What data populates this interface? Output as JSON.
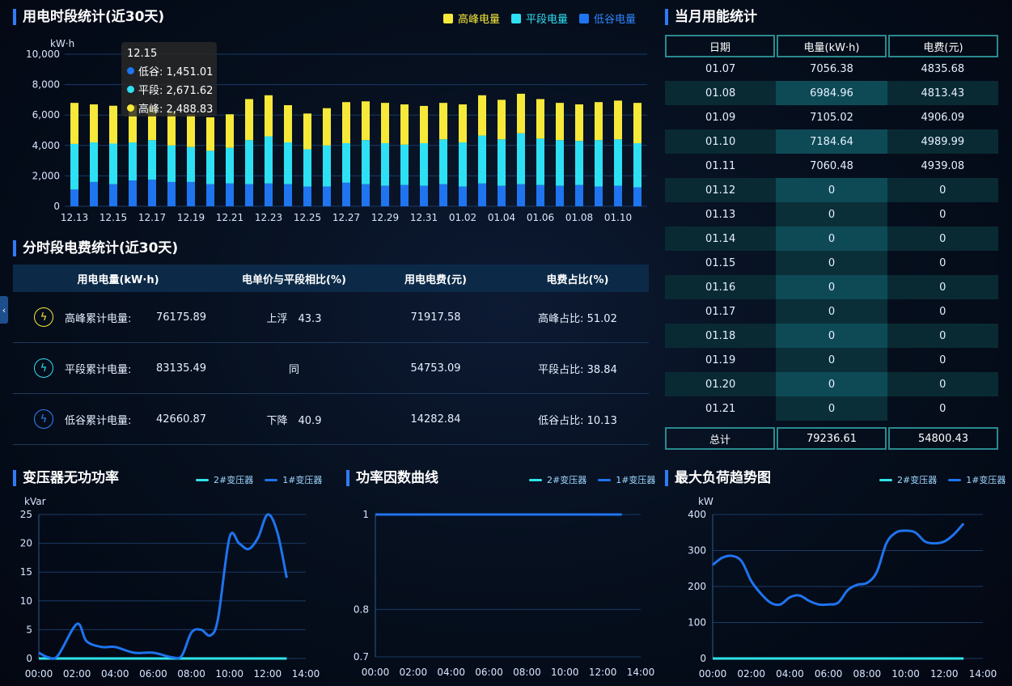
{
  "colors": {
    "peak": "#f7e93a",
    "flat": "#2ee0f4",
    "valley": "#1f74ef",
    "t2": "#2fe4e8",
    "t1": "#1f74ef"
  },
  "usage_chart": {
    "title": "用电时段统计(近30天)",
    "unit": "kW·h",
    "legend": {
      "peak": "高峰电量",
      "flat": "平段电量",
      "valley": "低谷电量"
    },
    "tooltip": {
      "date": "12.15",
      "valley": "低谷: 1,451.01",
      "flat": "平段: 2,671.62",
      "peak": "高峰: 2,488.83"
    },
    "chart_data": {
      "type": "bar",
      "title": "用电时段统计(近30天)",
      "ylabel": "kW·h",
      "ylim": [
        0,
        10000
      ],
      "yticks": [
        "10,000",
        "8,000",
        "6,000",
        "4,000",
        "2,000",
        "0"
      ],
      "xticks": [
        "12.13",
        "12.15",
        "12.17",
        "12.19",
        "12.21",
        "12.23",
        "12.25",
        "12.27",
        "12.29",
        "12.31",
        "01.02",
        "01.04",
        "01.06",
        "01.08",
        "01.10"
      ],
      "categories": [
        "12.13",
        "12.14",
        "12.15",
        "12.16",
        "12.17",
        "12.18",
        "12.19",
        "12.20",
        "12.21",
        "12.22",
        "12.23",
        "12.24",
        "12.25",
        "12.26",
        "12.27",
        "12.28",
        "12.29",
        "12.30",
        "12.31",
        "01.01",
        "01.02",
        "01.03",
        "01.04",
        "01.05",
        "01.06",
        "01.07",
        "01.08",
        "01.09",
        "01.10",
        "01.11"
      ],
      "series": [
        {
          "name": "低谷电量",
          "values": [
            1100,
            1600,
            1451.01,
            1700,
            1750,
            1600,
            1600,
            1450,
            1500,
            1450,
            1500,
            1450,
            1300,
            1300,
            1550,
            1450,
            1350,
            1400,
            1350,
            1450,
            1300,
            1500,
            1350,
            1450,
            1400,
            1350,
            1400,
            1300,
            1350,
            1250
          ]
        },
        {
          "name": "平段电量",
          "values": [
            3000,
            2600,
            2671.62,
            2500,
            2600,
            2400,
            2300,
            2200,
            2350,
            2900,
            3100,
            2750,
            2450,
            2700,
            2600,
            2900,
            2800,
            2650,
            2800,
            2950,
            2900,
            3150,
            3050,
            3350,
            3050,
            3000,
            2900,
            3050,
            3050,
            2900
          ]
        },
        {
          "name": "高峰电量",
          "values": [
            2700,
            2500,
            2488.83,
            2450,
            2200,
            2250,
            2150,
            2200,
            2200,
            2700,
            2700,
            2450,
            2350,
            2450,
            2700,
            2550,
            2650,
            2650,
            2450,
            2400,
            2500,
            2650,
            2600,
            2600,
            2600,
            2450,
            2400,
            2500,
            2550,
            2650
          ]
        }
      ]
    }
  },
  "fee_table": {
    "title": "分时段电费统计(近30天)",
    "headers": [
      "用电电量(kW·h)",
      "电单价与平段相比(%)",
      "用电电费(元)",
      "电费占比(%)"
    ],
    "rows": [
      {
        "label": "高峰累计电量:",
        "value": "76175.89",
        "cmp": "上浮　43.3",
        "fee": "71917.58",
        "ratio": "高峰占比:  51.02",
        "icon": "lightning-peak-icon"
      },
      {
        "label": "平段累计电量:",
        "value": "83135.49",
        "cmp": "同",
        "fee": "54753.09",
        "ratio": "平段占比:  38.84",
        "icon": "lightning-flat-icon"
      },
      {
        "label": "低谷累计电量:",
        "value": "42660.87",
        "cmp": "下降　40.9",
        "fee": "14282.84",
        "ratio": "低谷占比:  10.13",
        "icon": "lightning-valley-icon"
      }
    ]
  },
  "month_table": {
    "title": "当月用能统计",
    "headers": [
      "日期",
      "电量(kW·h)",
      "电费(元)"
    ],
    "rows": [
      [
        "01.07",
        "7056.38",
        "4835.68"
      ],
      [
        "01.08",
        "6984.96",
        "4813.43"
      ],
      [
        "01.09",
        "7105.02",
        "4906.09"
      ],
      [
        "01.10",
        "7184.64",
        "4989.99"
      ],
      [
        "01.11",
        "7060.48",
        "4939.08"
      ],
      [
        "01.12",
        "0",
        "0"
      ],
      [
        "01.13",
        "0",
        "0"
      ],
      [
        "01.14",
        "0",
        "0"
      ],
      [
        "01.15",
        "0",
        "0"
      ],
      [
        "01.16",
        "0",
        "0"
      ],
      [
        "01.17",
        "0",
        "0"
      ],
      [
        "01.18",
        "0",
        "0"
      ],
      [
        "01.19",
        "0",
        "0"
      ],
      [
        "01.20",
        "0",
        "0"
      ],
      [
        "01.21",
        "0",
        "0"
      ]
    ],
    "footer": [
      "总计",
      "79236.61",
      "54800.43"
    ]
  },
  "line_charts": [
    {
      "title": "变压器无功功率",
      "legend": [
        "2#变压器",
        "1#变压器"
      ],
      "chart_data": {
        "type": "line",
        "ylabel": "kVar",
        "ylim": [
          0,
          25
        ],
        "yticks": [
          "25",
          "20",
          "15",
          "10",
          "5",
          "0"
        ],
        "xticks": [
          "00:00",
          "02:00",
          "04:00",
          "06:00",
          "08:00",
          "10:00",
          "12:00",
          "14:00"
        ],
        "xlim": [
          0,
          14
        ],
        "series": [
          {
            "name": "2#变压器",
            "x": [
              0,
              1,
              2,
              3,
              4,
              5,
              6,
              7,
              8,
              9,
              10,
              11,
              12,
              13
            ],
            "values": [
              0,
              0,
              0,
              0,
              0,
              0,
              0,
              0,
              0,
              0,
              0,
              0,
              0,
              0
            ]
          },
          {
            "name": "1#变压器",
            "x": [
              0,
              0.5,
              1,
              2,
              2.5,
              3.3,
              4,
              5,
              6,
              7,
              7.5,
              8,
              8.5,
              9,
              9.4,
              10,
              10.5,
              11,
              11.5,
              12,
              12.5,
              13
            ],
            "values": [
              1,
              0.2,
              0.5,
              6,
              3,
              2,
              2,
              1,
              1,
              0.2,
              0.5,
              4.5,
              5,
              4,
              7,
              21,
              20,
              19,
              21,
              25,
              22,
              14
            ]
          }
        ]
      }
    },
    {
      "title": "功率因数曲线",
      "legend": [
        "2#变压器",
        "1#变压器"
      ],
      "chart_data": {
        "type": "line",
        "ylim": [
          0.7,
          1
        ],
        "yticks": [
          "1",
          "0.8",
          "0.7"
        ],
        "xticks": [
          "00:00",
          "02:00",
          "04:00",
          "06:00",
          "08:00",
          "10:00",
          "12:00",
          "14:00"
        ],
        "xlim": [
          0,
          14
        ],
        "series": [
          {
            "name": "2#变压器",
            "x": [
              0,
              13
            ],
            "values": [
              1,
              1
            ]
          },
          {
            "name": "1#变压器",
            "x": [
              0,
              13
            ],
            "values": [
              1,
              1
            ]
          }
        ]
      }
    },
    {
      "title": "最大负荷趋势图",
      "legend": [
        "2#变压器",
        "1#变压器"
      ],
      "chart_data": {
        "type": "line",
        "ylabel": "kW",
        "ylim": [
          0,
          400
        ],
        "yticks": [
          "400",
          "300",
          "200",
          "100",
          "0"
        ],
        "xticks": [
          "00:00",
          "02:00",
          "04:00",
          "06:00",
          "08:00",
          "10:00",
          "12:00",
          "14:00"
        ],
        "xlim": [
          0,
          14
        ],
        "series": [
          {
            "name": "2#变压器",
            "x": [
              0,
              13
            ],
            "values": [
              0,
              0
            ]
          },
          {
            "name": "1#变压器",
            "x": [
              0,
              0.5,
              1,
              1.5,
              2,
              2.5,
              3,
              3.5,
              4,
              4.5,
              5,
              5.5,
              6,
              6.5,
              7,
              7.5,
              8,
              8.5,
              9,
              9.5,
              10,
              10.5,
              11,
              11.5,
              12,
              12.5,
              13
            ],
            "values": [
              260,
              280,
              285,
              270,
              215,
              180,
              155,
              150,
              170,
              175,
              160,
              150,
              150,
              155,
              190,
              205,
              210,
              240,
              320,
              350,
              355,
              350,
              325,
              320,
              325,
              345,
              375
            ]
          }
        ]
      }
    }
  ]
}
